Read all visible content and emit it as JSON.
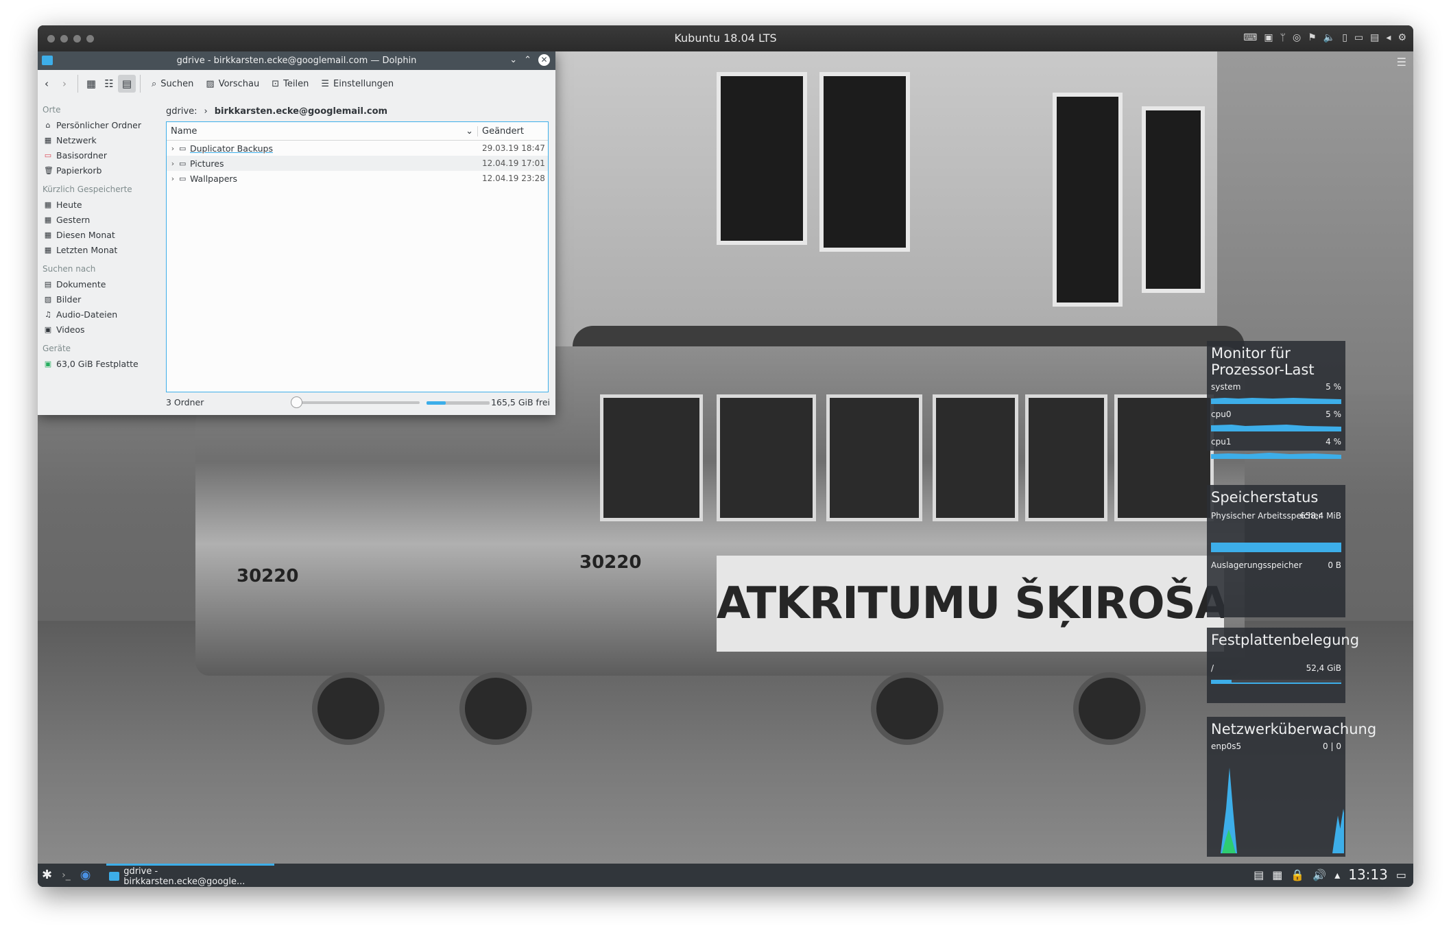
{
  "vm": {
    "title": "Kubuntu 18.04 LTS"
  },
  "dolphin": {
    "title": "gdrive - birkkarsten.ecke@googlemail.com — Dolphin",
    "toolbar": {
      "search": "Suchen",
      "preview": "Vorschau",
      "share": "Teilen",
      "settings": "Einstellungen"
    },
    "places": {
      "h_places": "Orte",
      "home": "Persönlicher Ordner",
      "network": "Netzwerk",
      "root": "Basisordner",
      "trash": "Papierkorb",
      "h_recent": "Kürzlich Gespeicherte",
      "today": "Heute",
      "yesterday": "Gestern",
      "this_month": "Diesen Monat",
      "last_month": "Letzten Monat",
      "h_search": "Suchen nach",
      "documents": "Dokumente",
      "images": "Bilder",
      "audio": "Audio-Dateien",
      "videos": "Videos",
      "h_devices": "Geräte",
      "disk": "63,0 GiB Festplatte"
    },
    "breadcrumb": {
      "root": "gdrive:",
      "current": "birkkarsten.ecke@googlemail.com"
    },
    "columns": {
      "name": "Name",
      "modified": "Geändert"
    },
    "files": [
      {
        "name": "Duplicator Backups",
        "date": "29.03.19 18:47"
      },
      {
        "name": "Pictures",
        "date": "12.04.19 17:01"
      },
      {
        "name": "Wallpapers",
        "date": "12.04.19 23:28"
      }
    ],
    "status": {
      "count": "3 Ordner",
      "free": "165,5 GiB frei",
      "used_fraction": 0.3
    }
  },
  "wallpaper": {
    "banner": "ATKRITUMU ŠĶIROŠANAS LAUKUMS",
    "tram_number": "30220"
  },
  "widgets": {
    "cpu": {
      "title": "Monitor für Prozessor-Last",
      "rows": [
        {
          "label": "system",
          "value": "5 %"
        },
        {
          "label": "cpu0",
          "value": "5 %"
        },
        {
          "label": "cpu1",
          "value": "4 %"
        }
      ]
    },
    "memory": {
      "title": "Speicherstatus",
      "physical_label": "Physischer Arbeitsspeicher",
      "physical_value": "658,4 MiB",
      "swap_label": "Auslagerungsspeicher",
      "swap_value": "0 B",
      "physical_fraction": 1.0
    },
    "disk": {
      "title": "Festplattenbelegung",
      "mount": "/",
      "value": "52,4 GiB",
      "fraction": 0.16
    },
    "network": {
      "title": "Netzwerküberwachung",
      "iface": "enp0s5",
      "value": "0 | 0"
    }
  },
  "taskbar": {
    "task_label": "gdrive - birkkarsten.ecke@google...",
    "clock": "13:13"
  }
}
